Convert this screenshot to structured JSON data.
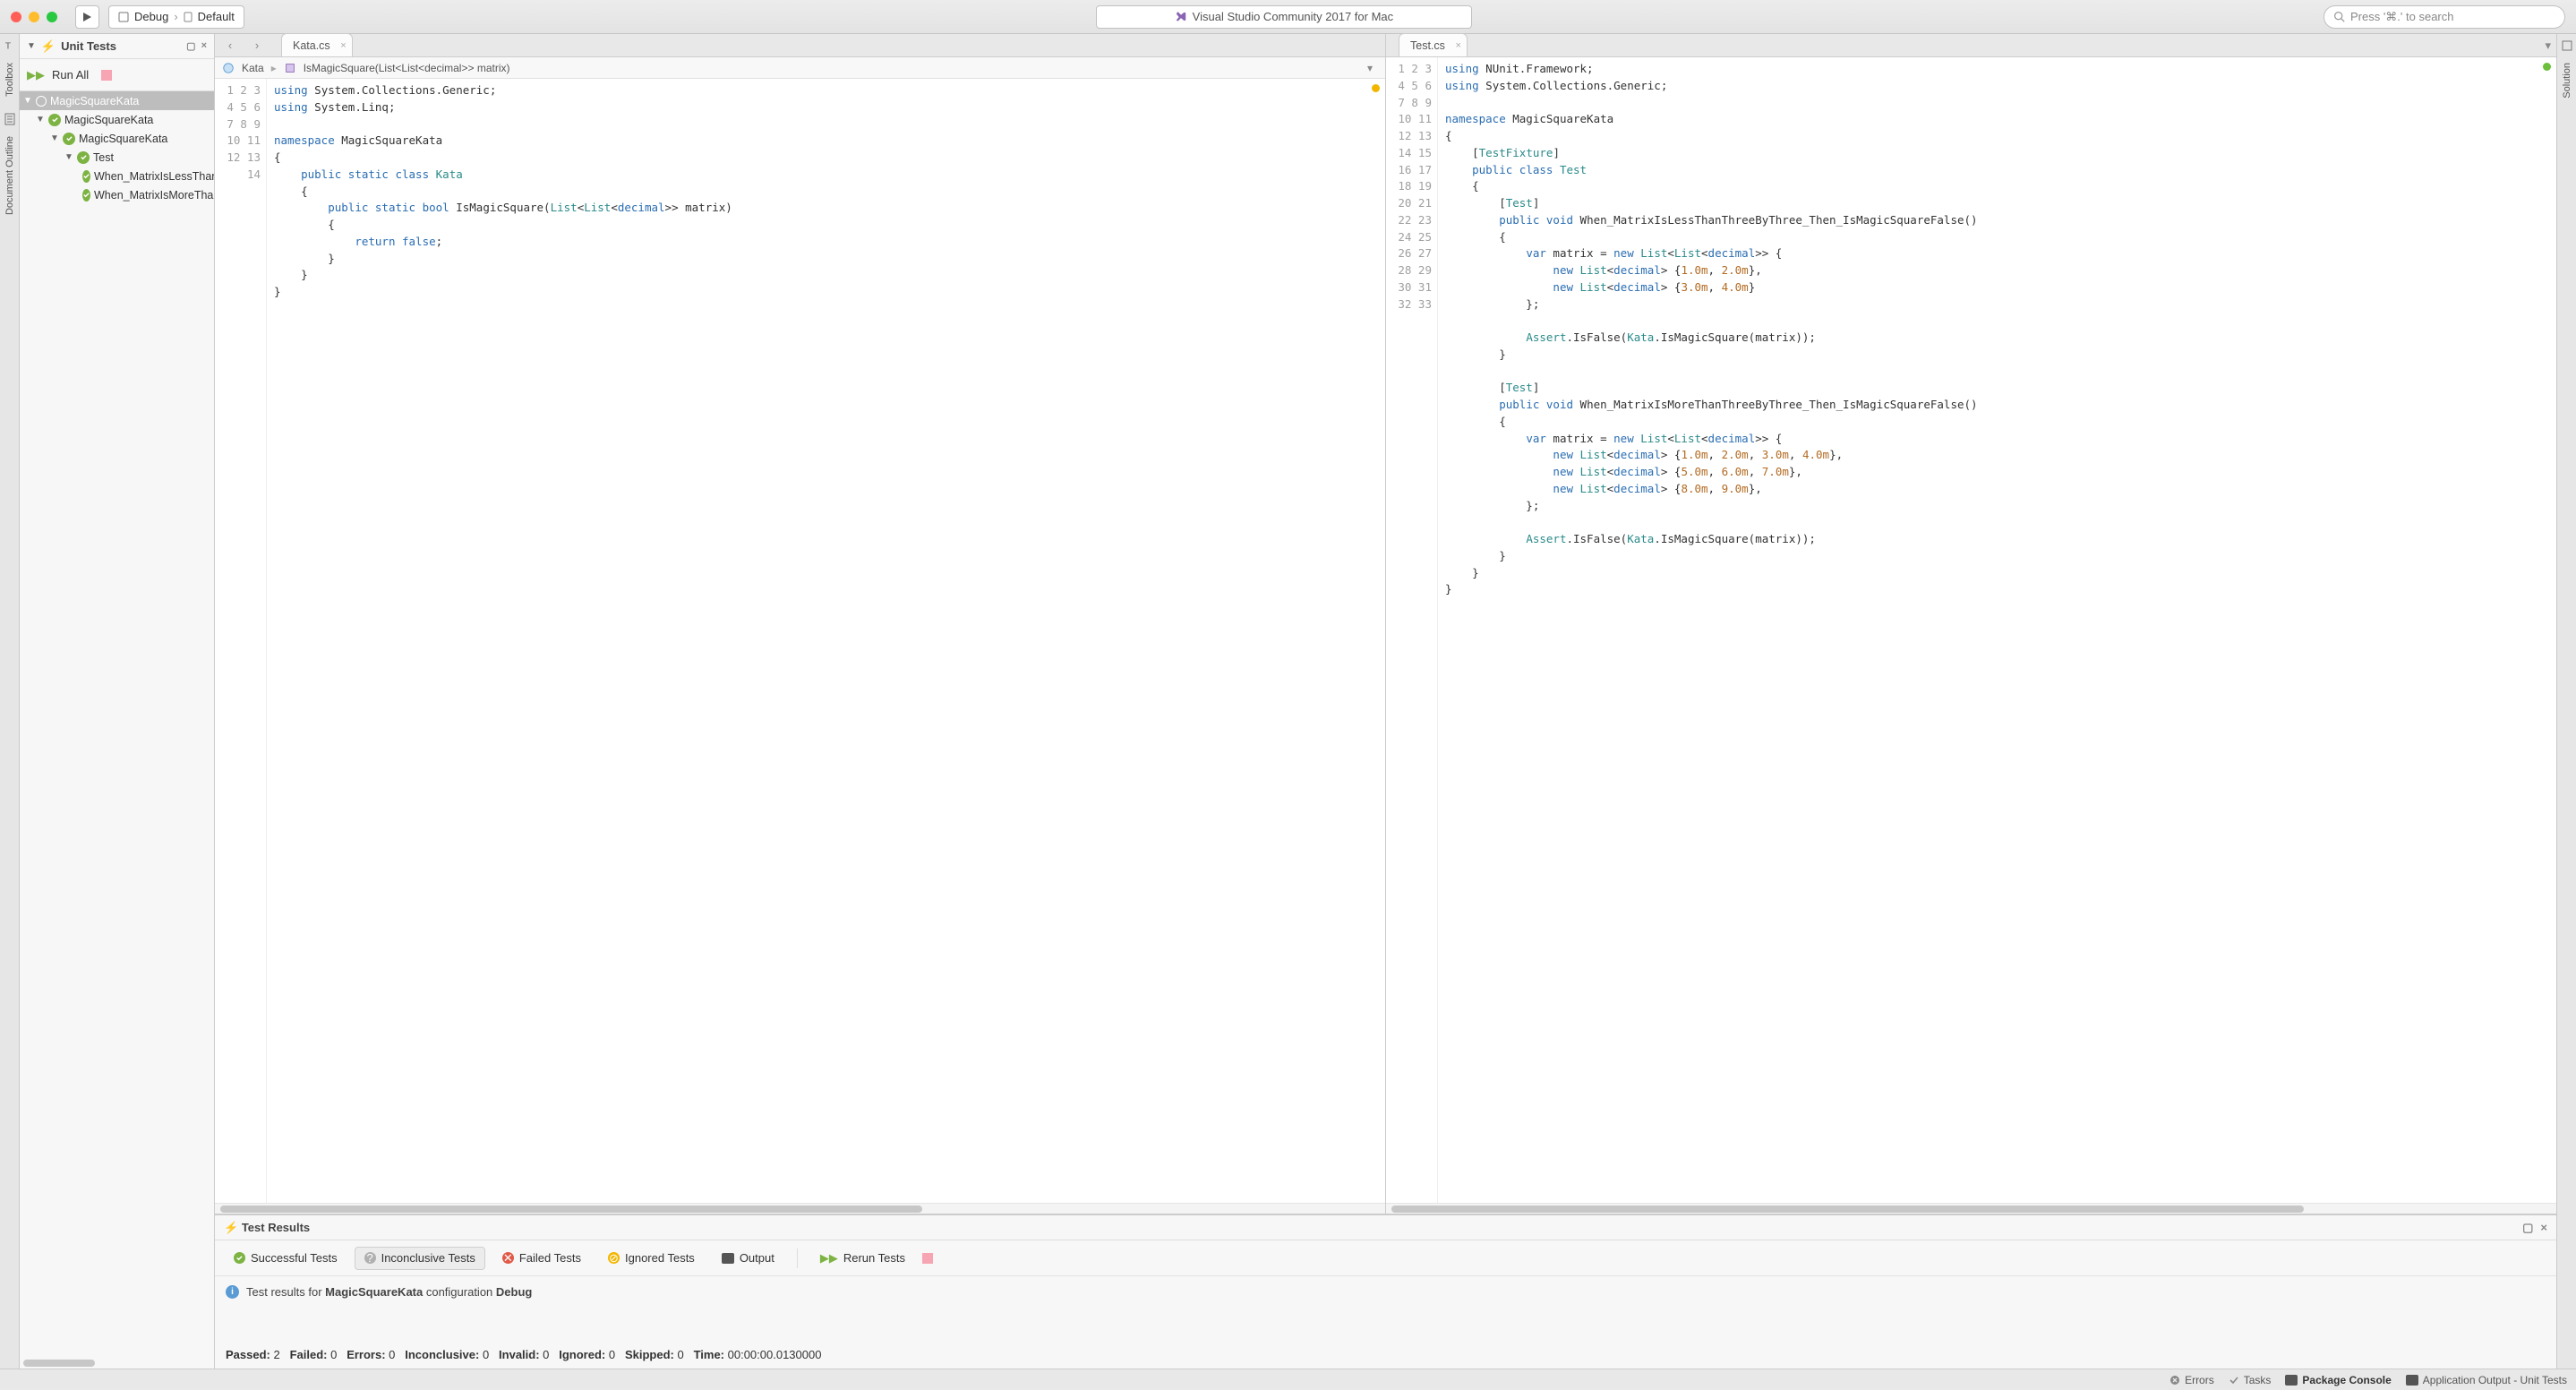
{
  "titlebar": {
    "config_label": "Debug",
    "target_label": "Default",
    "center_title": "Visual Studio Community 2017 for Mac",
    "search_placeholder": "Press '⌘.' to search"
  },
  "left_rail": {
    "items": [
      "Toolbox",
      "Document Outline"
    ]
  },
  "right_rail": {
    "items": [
      "Solution"
    ]
  },
  "unit_tests": {
    "title": "Unit Tests",
    "run_all": "Run All",
    "tree": {
      "root": "MagicSquareKata",
      "l1": "MagicSquareKata",
      "l2": "MagicSquareKata",
      "l3": "Test",
      "leaf1": "When_MatrixIsLessThanThreeByThree_Then_IsMagicSquareFalse",
      "leaf2": "When_MatrixIsMoreThanThreeByThree_Then_IsMagicSquareFalse"
    }
  },
  "editor_left": {
    "tab": "Kata.cs",
    "breadcrumb": {
      "class": "Kata",
      "method": "IsMagicSquare(List<List<decimal>> matrix)"
    },
    "gutter": [
      "1",
      "2",
      "3",
      "4",
      "5",
      "6",
      "7",
      "8",
      "9",
      "10",
      "11",
      "12",
      "13",
      "14"
    ]
  },
  "editor_right": {
    "tab": "Test.cs",
    "gutter": [
      "1",
      "2",
      "3",
      "4",
      "5",
      "6",
      "7",
      "8",
      "9",
      "10",
      "11",
      "12",
      "13",
      "14",
      "15",
      "16",
      "17",
      "18",
      "19",
      "20",
      "21",
      "22",
      "23",
      "24",
      "25",
      "26",
      "27",
      "28",
      "29",
      "30",
      "31",
      "32",
      "33"
    ]
  },
  "results": {
    "title": "Test Results",
    "filters": {
      "success": "Successful Tests",
      "inconclusive": "Inconclusive Tests",
      "failed": "Failed Tests",
      "ignored": "Ignored Tests",
      "output": "Output",
      "rerun": "Rerun Tests"
    },
    "info_prefix": "Test results for ",
    "info_project": "MagicSquareKata",
    "info_middle": " configuration ",
    "info_config": "Debug",
    "summary": {
      "passed_l": "Passed:",
      "passed_v": "2",
      "failed_l": "Failed:",
      "failed_v": "0",
      "errors_l": "Errors:",
      "errors_v": "0",
      "inconclusive_l": "Inconclusive:",
      "inconclusive_v": "0",
      "invalid_l": "Invalid:",
      "invalid_v": "0",
      "ignored_l": "Ignored:",
      "ignored_v": "0",
      "skipped_l": "Skipped:",
      "skipped_v": "0",
      "time_l": "Time:",
      "time_v": "00:00:00.0130000"
    }
  },
  "statusbar": {
    "errors": "Errors",
    "tasks": "Tasks",
    "package": "Package Console",
    "output": "Application Output - Unit Tests"
  }
}
